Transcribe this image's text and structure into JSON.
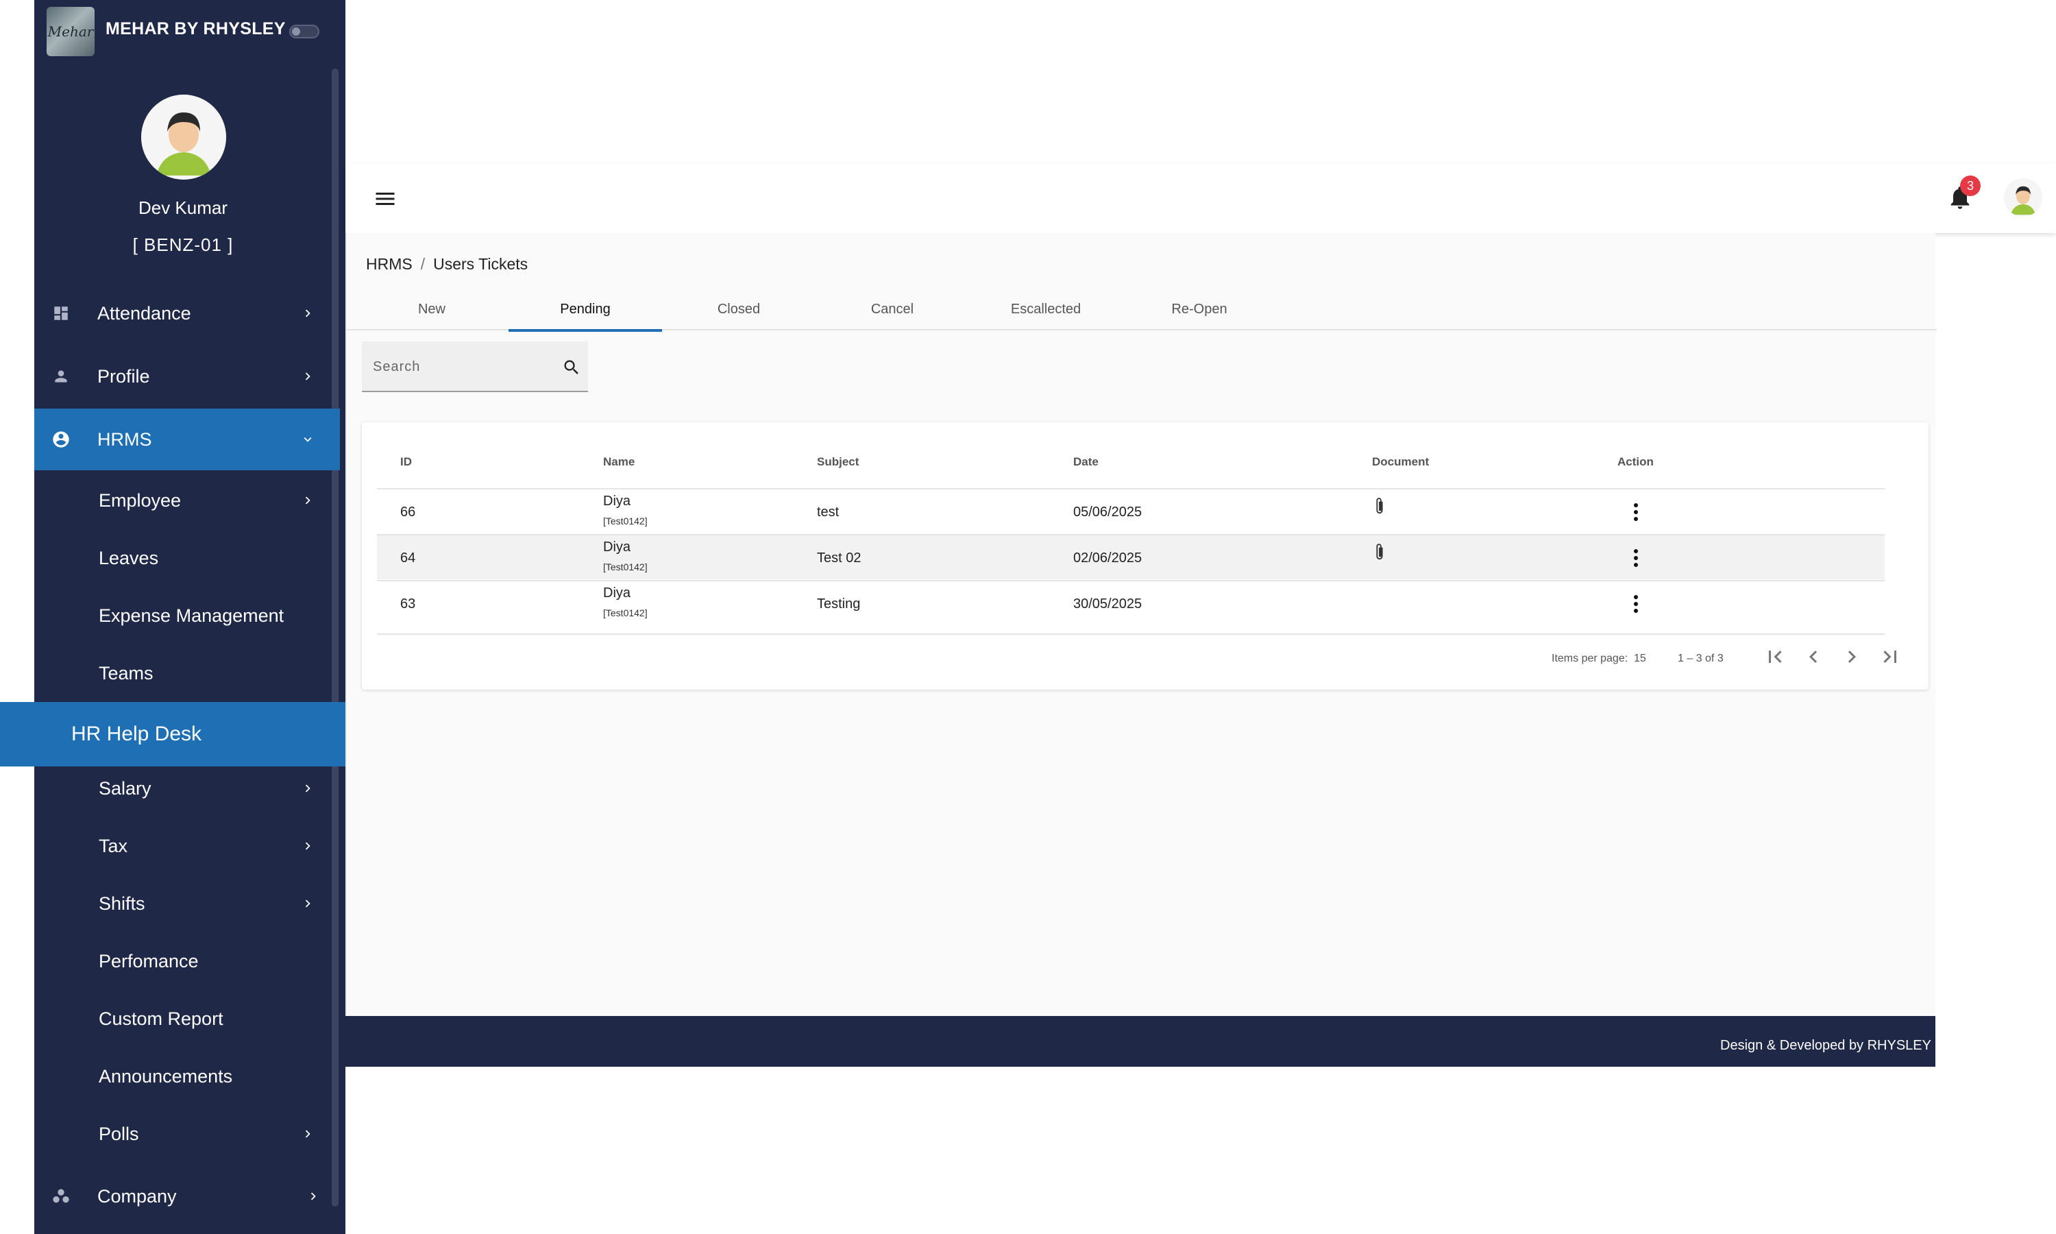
{
  "app": {
    "brand": "MEHAR BY RHYSLEY",
    "logo_text": "Mehar"
  },
  "user": {
    "name": "Dev Kumar",
    "code": "[ BENZ-01 ]"
  },
  "sidebar": {
    "items": [
      {
        "label": "Attendance",
        "icon": "dashboard-icon"
      },
      {
        "label": "Profile",
        "icon": "person-icon"
      },
      {
        "label": "HRMS",
        "icon": "account-circle-icon"
      },
      {
        "label": "Company",
        "icon": "group-icon"
      }
    ],
    "hrms_sub": [
      {
        "label": "Employee"
      },
      {
        "label": "Leaves"
      },
      {
        "label": "Expense Management"
      },
      {
        "label": "Teams"
      },
      {
        "label": "HR Help Desk"
      },
      {
        "label": "Salary"
      },
      {
        "label": "Tax"
      },
      {
        "label": "Shifts"
      },
      {
        "label": "Perfomance"
      },
      {
        "label": "Custom Report"
      },
      {
        "label": "Announcements"
      },
      {
        "label": "Polls"
      }
    ]
  },
  "topbar": {
    "notification_count": "3"
  },
  "breadcrumb": {
    "root": "HRMS",
    "separator": "/",
    "current": "Users Tickets"
  },
  "tabs": [
    "New",
    "Pending",
    "Closed",
    "Cancel",
    "Escallected",
    "Re-Open"
  ],
  "active_tab": "Pending",
  "search": {
    "placeholder": "Search"
  },
  "table": {
    "headers": [
      "ID",
      "Name",
      "Subject",
      "Date",
      "Document",
      "Action"
    ],
    "rows": [
      {
        "id": "66",
        "name": "Diya",
        "code": "[Test0142]",
        "subject": "test",
        "date": "05/06/2025",
        "has_document": true
      },
      {
        "id": "64",
        "name": "Diya",
        "code": "[Test0142]",
        "subject": "Test 02",
        "date": "02/06/2025",
        "has_document": true
      },
      {
        "id": "63",
        "name": "Diya",
        "code": "[Test0142]",
        "subject": "Testing",
        "date": "30/05/2025",
        "has_document": false
      }
    ]
  },
  "pagination": {
    "items_per_page_label": "Items per page:",
    "items_per_page": "15",
    "range": "1 – 3 of 3"
  },
  "footer": {
    "text": "Design & Developed by  RHYSLEY"
  },
  "colors": {
    "sidebar_bg": "#1f2846",
    "accent": "#1f6fb5",
    "badge": "#e53946"
  }
}
